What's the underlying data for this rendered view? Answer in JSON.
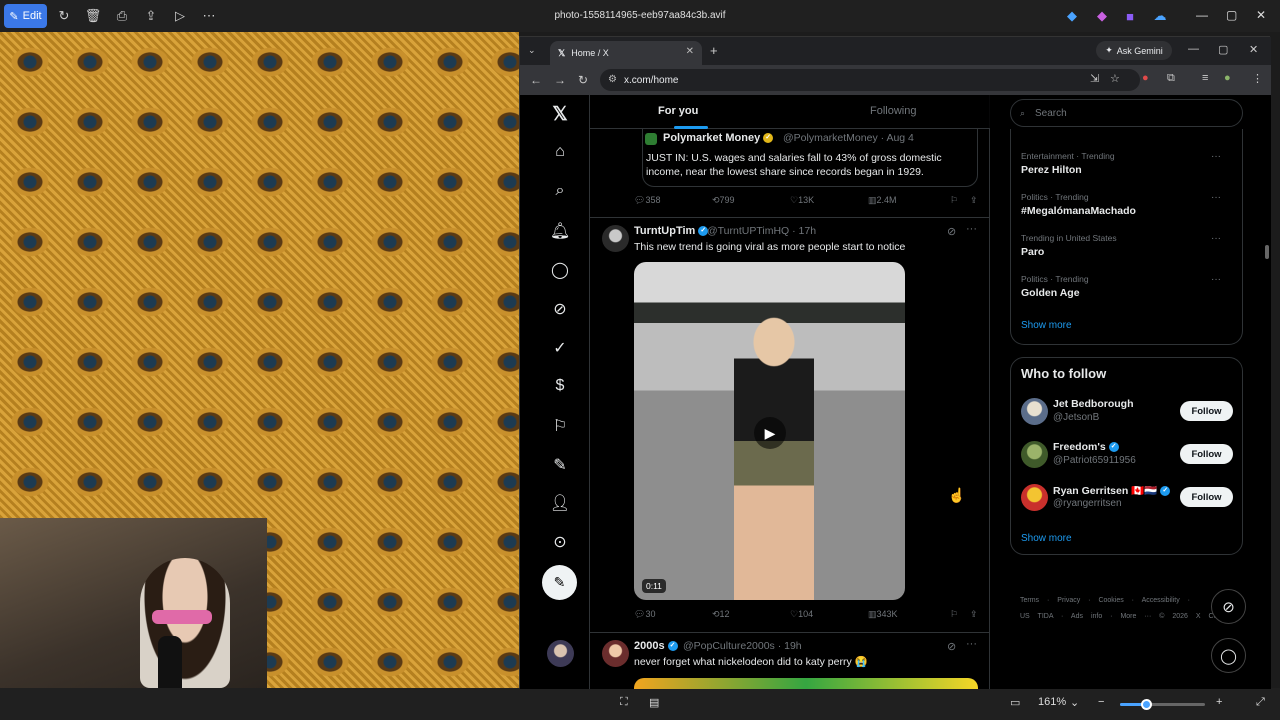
{
  "viewer": {
    "title": "photo-1558114965-eeb97aa84c3b.avif",
    "edit_label": "Edit",
    "zoom_level": "161%",
    "zoom_fraction": 0.3
  },
  "browser": {
    "tab_title": "Home / X",
    "url": "x.com/home",
    "gemini_label": "Ask Gemini"
  },
  "x": {
    "tabs": {
      "for_you": "For you",
      "following": "Following"
    },
    "quote": {
      "name": "Polymarket Money",
      "handle": "@PolymarketMoney · Aug 4",
      "text": "JUST IN: U.S. wages and salaries fall to 43% of gross domestic income, near the lowest share since records began in 1929."
    },
    "quote_actions": {
      "replies": "358",
      "reposts": "799",
      "likes": "13K",
      "views": "2.4M"
    },
    "tweet1": {
      "name": "TurntUpTim",
      "handle": "@TurntUPTimHQ · 17h",
      "text": "This new trend is going viral as more people start to notice",
      "duration": "0:11"
    },
    "tweet1_actions": {
      "replies": "30",
      "reposts": "12",
      "likes": "104",
      "views": "343K"
    },
    "tweet2": {
      "name": "2000s",
      "handle": "@PopCulture2000s · 19h",
      "text": "never forget what nickelodeon did to katy perry 😭"
    },
    "search_placeholder": "Search",
    "trends": [
      {
        "category": "Entertainment · Trending",
        "name": "Perez Hilton"
      },
      {
        "category": "Politics · Trending",
        "name": "#MegalómanaMachado"
      },
      {
        "category": "Trending in United States",
        "name": "Paro"
      },
      {
        "category": "Politics · Trending",
        "name": "Golden Age"
      }
    ],
    "show_more": "Show more",
    "who_to_follow_title": "Who to follow",
    "follow_suggestions": [
      {
        "name": "Jet Bedborough",
        "handle": "@JetsonB",
        "button": "Follow"
      },
      {
        "name": "Freedom's",
        "handle": "@Patriot65911956",
        "button": "Follow"
      },
      {
        "name": "Ryan Gerritsen 🇨🇦🇳🇱",
        "handle": "@ryangerritsen",
        "button": "Follow"
      }
    ],
    "footer_line1": "Terms · Privacy · Cookies · Accessibility ·",
    "footer_line2": "US TIDA · Ads info · More ··· © 2026 X Corp."
  },
  "colors": {
    "x_blue": "#1d9bf0",
    "viewer_accent": "#3b78e7"
  },
  "icons": [
    "x-logo-icon",
    "home-icon",
    "search-icon",
    "bell-icon",
    "message-icon",
    "grok-icon",
    "verified-icon",
    "money-icon",
    "bookmark-icon",
    "edit-icon",
    "profile-icon",
    "more-icon",
    "compose-icon"
  ]
}
